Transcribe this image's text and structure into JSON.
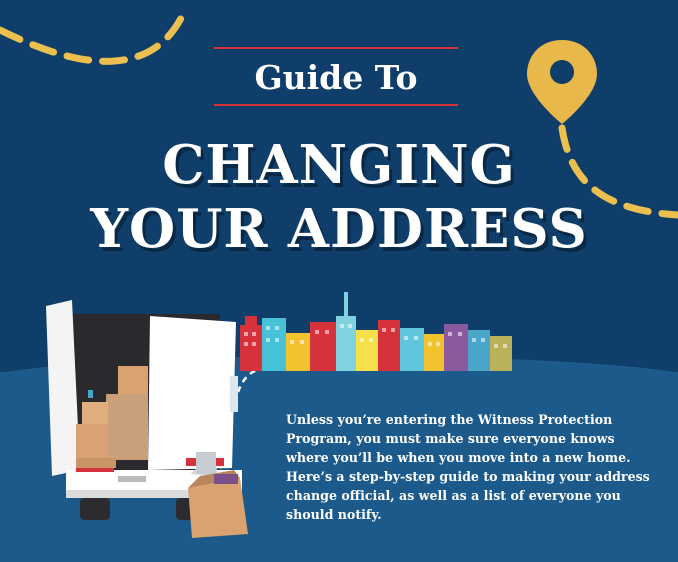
{
  "header": {
    "kicker": "Guide To",
    "headline_line1": "CHANGING",
    "headline_line2": "YOUR ADDRESS"
  },
  "intro": {
    "paragraph": "Unless you’re entering the Witness Protection Program, you must make sure everyone knows where you’ll be when you move into a new home. Here’s a step-by-step guide to making your address change official, as well as a list of everyone you should notify."
  },
  "colors": {
    "background": "#0f3e6a",
    "lower_band": "#1c5a8c",
    "accent_red": "#d6323c",
    "pin_yellow": "#e9b84a",
    "dash_yellow": "#ecc04f"
  },
  "icons": [
    "location-pin-icon",
    "moving-truck-illustration",
    "city-skyline-illustration",
    "cardboard-box-illustration",
    "lamp-illustration"
  ]
}
